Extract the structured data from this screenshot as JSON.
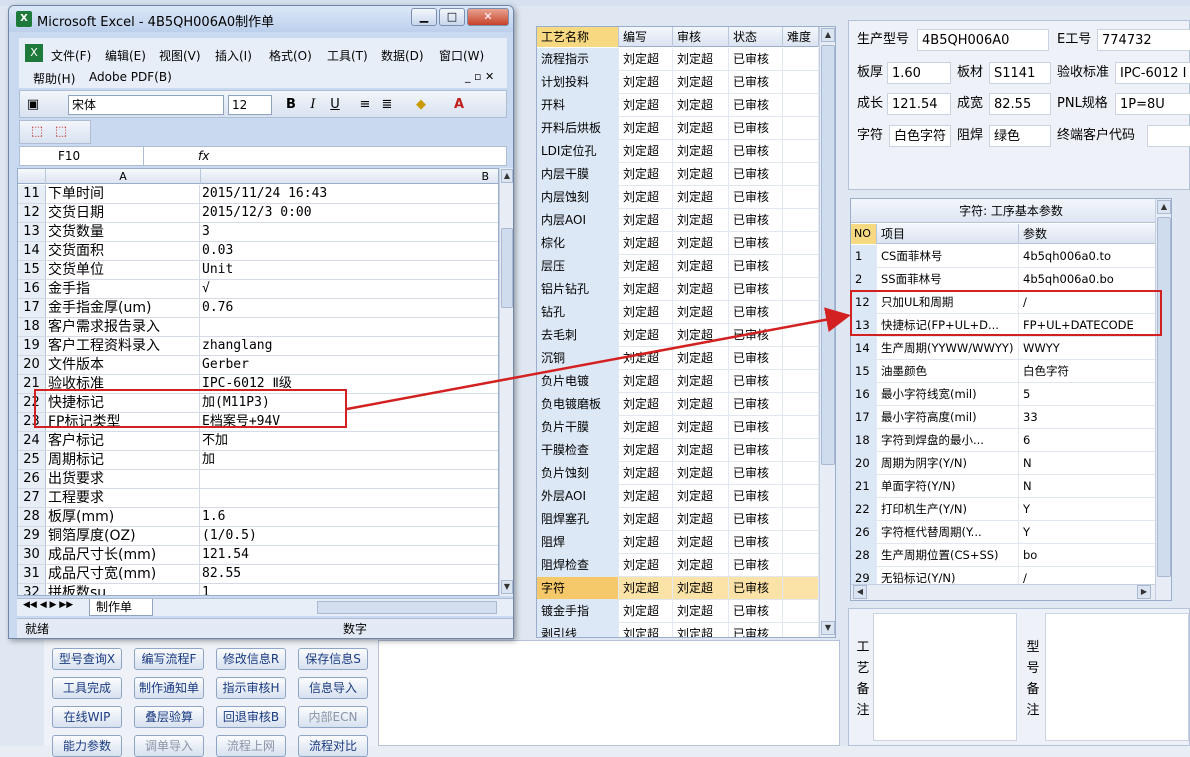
{
  "excel": {
    "title": "Microsoft Excel - 4B5QH006A0制作单",
    "menu": [
      "文件(F)",
      "编辑(E)",
      "视图(V)",
      "插入(I)",
      "格式(O)",
      "工具(T)",
      "数据(D)",
      "窗口(W)",
      "帮助(H)",
      "Adobe PDF(B)"
    ],
    "font_name": "宋体",
    "font_size": "12",
    "name_box": "F10",
    "fx": "fx",
    "col_a": "A",
    "col_b": "B",
    "rows": [
      {
        "n": "11",
        "a": "下单时间",
        "b": "2015/11/24 16:43"
      },
      {
        "n": "12",
        "a": "交货日期",
        "b": "2015/12/3 0:00"
      },
      {
        "n": "13",
        "a": "交货数量",
        "b": "3"
      },
      {
        "n": "14",
        "a": "交货面积",
        "b": "0.03"
      },
      {
        "n": "15",
        "a": "交货单位",
        "b": "Unit"
      },
      {
        "n": "16",
        "a": "金手指",
        "b": "√"
      },
      {
        "n": "17",
        "a": "金手指金厚(um)",
        "b": "0.76"
      },
      {
        "n": "18",
        "a": "客户需求报告录入",
        "b": ""
      },
      {
        "n": "19",
        "a": "客户工程资料录入",
        "b": "zhanglang"
      },
      {
        "n": "20",
        "a": "文件版本",
        "b": "Gerber"
      },
      {
        "n": "21",
        "a": "验收标准",
        "b": "IPC-6012 Ⅱ级"
      },
      {
        "n": "22",
        "a": "快捷标记",
        "b": "加(M11P3)"
      },
      {
        "n": "23",
        "a": "FP标记类型",
        "b": "E档案号+94V"
      },
      {
        "n": "24",
        "a": "客户标记",
        "b": "不加"
      },
      {
        "n": "25",
        "a": "周期标记",
        "b": "加"
      },
      {
        "n": "26",
        "a": "出货要求",
        "b": ""
      },
      {
        "n": "27",
        "a": "工程要求",
        "b": ""
      },
      {
        "n": "28",
        "a": "板厚(mm)",
        "b": "1.6"
      },
      {
        "n": "29",
        "a": "铜箔厚度(OZ)",
        "b": "(1/0.5)"
      },
      {
        "n": "30",
        "a": "成品尺寸长(mm)",
        "b": "121.54"
      },
      {
        "n": "31",
        "a": "成品尺寸宽(mm)",
        "b": "82.55"
      },
      {
        "n": "32",
        "a": "拼板数su",
        "b": "1"
      }
    ],
    "sheet_tab": "制作单",
    "status_ready": "就绪",
    "status_num": "数字"
  },
  "process": {
    "headers": [
      "工艺名称",
      "编写",
      "审核",
      "状态",
      "难度"
    ],
    "rows": [
      [
        "流程指示",
        "刘定超",
        "刘定超",
        "已审核"
      ],
      [
        "计划投料",
        "刘定超",
        "刘定超",
        "已审核"
      ],
      [
        "开料",
        "刘定超",
        "刘定超",
        "已审核"
      ],
      [
        "开料后烘板",
        "刘定超",
        "刘定超",
        "已审核"
      ],
      [
        "LDI定位孔",
        "刘定超",
        "刘定超",
        "已审核"
      ],
      [
        "内层干膜",
        "刘定超",
        "刘定超",
        "已审核"
      ],
      [
        "内层蚀刻",
        "刘定超",
        "刘定超",
        "已审核"
      ],
      [
        "内层AOI",
        "刘定超",
        "刘定超",
        "已审核"
      ],
      [
        "棕化",
        "刘定超",
        "刘定超",
        "已审核"
      ],
      [
        "层压",
        "刘定超",
        "刘定超",
        "已审核"
      ],
      [
        "铝片钻孔",
        "刘定超",
        "刘定超",
        "已审核"
      ],
      [
        "钻孔",
        "刘定超",
        "刘定超",
        "已审核"
      ],
      [
        "去毛刺",
        "刘定超",
        "刘定超",
        "已审核"
      ],
      [
        "沉铜",
        "刘定超",
        "刘定超",
        "已审核"
      ],
      [
        "负片电镀",
        "刘定超",
        "刘定超",
        "已审核"
      ],
      [
        "负电镀磨板",
        "刘定超",
        "刘定超",
        "已审核"
      ],
      [
        "负片干膜",
        "刘定超",
        "刘定超",
        "已审核"
      ],
      [
        "干膜检查",
        "刘定超",
        "刘定超",
        "已审核"
      ],
      [
        "负片蚀刻",
        "刘定超",
        "刘定超",
        "已审核"
      ],
      [
        "外层AOI",
        "刘定超",
        "刘定超",
        "已审核"
      ],
      [
        "阻焊塞孔",
        "刘定超",
        "刘定超",
        "已审核"
      ],
      [
        "阻焊",
        "刘定超",
        "刘定超",
        "已审核"
      ],
      [
        "阻焊检查",
        "刘定超",
        "刘定超",
        "已审核"
      ],
      [
        "字符",
        "刘定超",
        "刘定超",
        "已审核"
      ],
      [
        "镀金手指",
        "刘定超",
        "刘定超",
        "已审核"
      ],
      [
        "剥引线",
        "刘定超",
        "刘定超",
        "已审核"
      ]
    ],
    "selected_index": 23
  },
  "info": {
    "model_label": "生产型号",
    "model": "4B5QH006A0",
    "e_label": "E工号",
    "e_value": "774732",
    "thick_label": "板厚",
    "thick": "1.60",
    "mat_label": "板材",
    "mat": "S1141",
    "std_label": "验收标准",
    "std": "IPC-6012 I",
    "len_label": "成长",
    "len": "121.54",
    "wid_label": "成宽",
    "wid": "82.55",
    "pnl_label": "PNL规格",
    "pnl": "1P=8U",
    "char_label": "字符",
    "char": "白色字符",
    "mask_label": "阻焊",
    "mask": "绿色",
    "cust_label": "终端客户代码",
    "cust": ""
  },
  "params": {
    "title": "字符: 工序基本参数",
    "headers": [
      "NO",
      "项目",
      "参数"
    ],
    "rows": [
      [
        "1",
        "CS面菲林号",
        "4b5qh006a0.to"
      ],
      [
        "2",
        "SS面菲林号",
        "4b5qh006a0.bo"
      ],
      [
        "12",
        "只加UL和周期",
        "/"
      ],
      [
        "13",
        "快捷标记(FP+UL+D...",
        "FP+UL+DATECODE"
      ],
      [
        "14",
        "生产周期(YYWW/WWYY)",
        "WWYY"
      ],
      [
        "15",
        "油墨颜色",
        "白色字符"
      ],
      [
        "16",
        "最小字符线宽(mil)",
        "5"
      ],
      [
        "17",
        "最小字符高度(mil)",
        "33"
      ],
      [
        "18",
        "字符到焊盘的最小...",
        "6"
      ],
      [
        "20",
        "周期为阴字(Y/N)",
        "N"
      ],
      [
        "21",
        "单面字符(Y/N)",
        "N"
      ],
      [
        "22",
        "打印机生产(Y/N)",
        "Y"
      ],
      [
        "26",
        "字符框代替周期(Y...",
        "Y"
      ],
      [
        "28",
        "生产周期位置(CS+SS)",
        "bo"
      ],
      [
        "29",
        "无铅标记(Y/N)",
        "/"
      ]
    ]
  },
  "notes": {
    "proc_note_label": "工艺备注",
    "model_note_label": "型号备注"
  },
  "buttons": [
    {
      "label": "型号查询X",
      "disabled": false
    },
    {
      "label": "编写流程F",
      "disabled": false
    },
    {
      "label": "修改信息R",
      "disabled": false
    },
    {
      "label": "保存信息S",
      "disabled": false
    },
    {
      "label": "工具完成",
      "disabled": false
    },
    {
      "label": "制作通知单",
      "disabled": false
    },
    {
      "label": "指示审核H",
      "disabled": false
    },
    {
      "label": "信息导入",
      "disabled": false
    },
    {
      "label": "在线WIP",
      "disabled": false
    },
    {
      "label": "叠层验算",
      "disabled": false
    },
    {
      "label": "回退审核B",
      "disabled": false
    },
    {
      "label": "内部ECN",
      "disabled": true
    },
    {
      "label": "能力参数",
      "disabled": false
    },
    {
      "label": "调单导入",
      "disabled": true
    },
    {
      "label": "流程上网",
      "disabled": true
    },
    {
      "label": "流程对比",
      "disabled": false
    }
  ],
  "colors": {
    "highlight": "#d32020",
    "selected_row": "#fbe3a8",
    "header_active": "#f7d981"
  }
}
